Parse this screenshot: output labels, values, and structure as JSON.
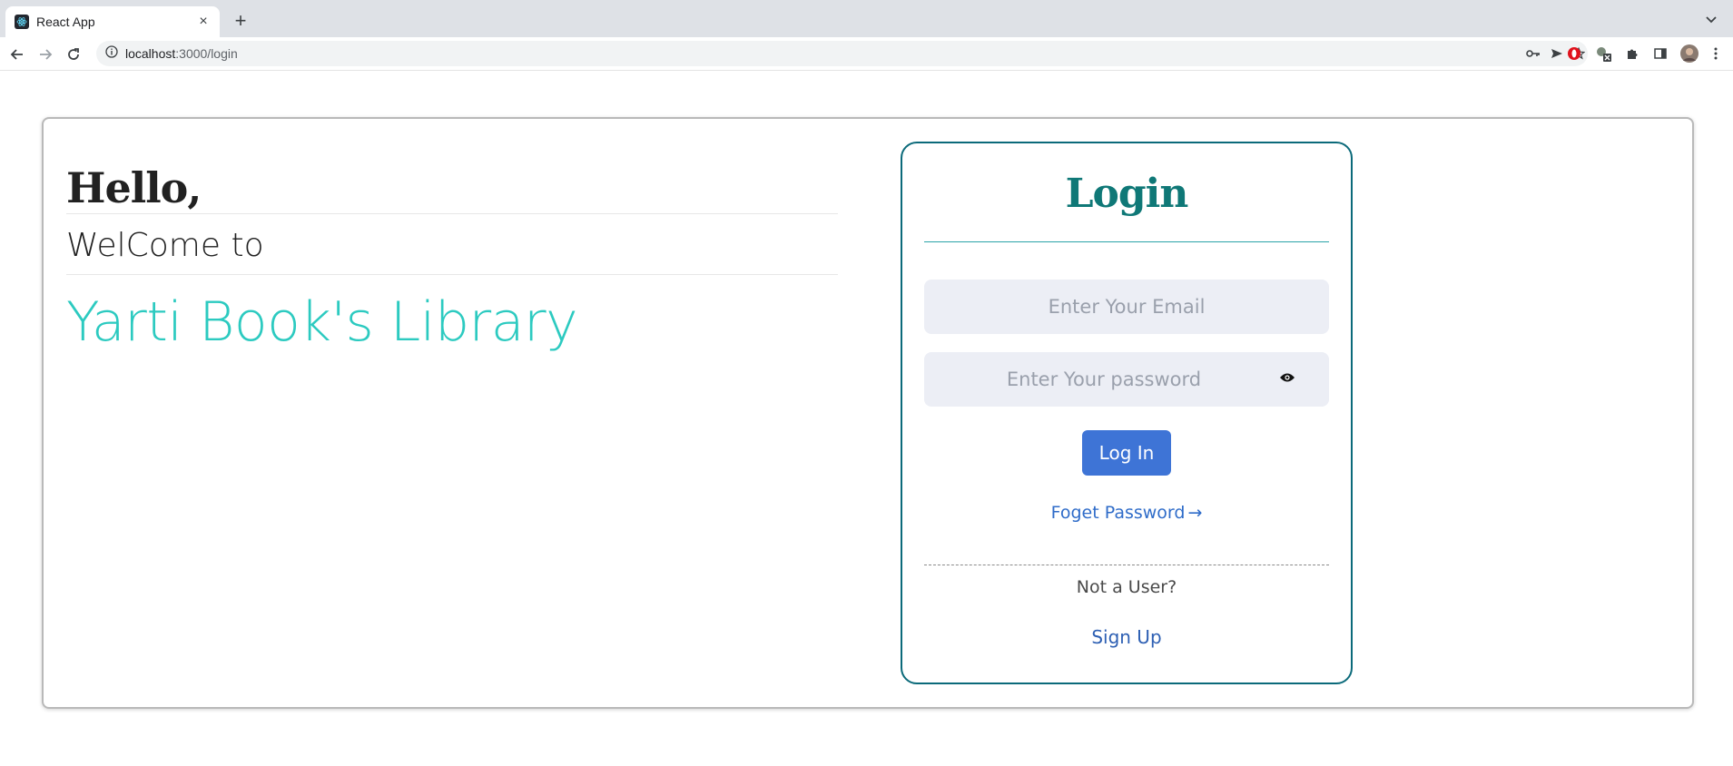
{
  "browser": {
    "tab_title": "React App",
    "new_tab_label": "+",
    "close_label": "×",
    "url_host": "localhost",
    "url_path": ":3000/login"
  },
  "page": {
    "greeting": "Hello,",
    "welcome": "WelCome to",
    "library_name": "Yarti Book's Library"
  },
  "login": {
    "title": "Login",
    "email_placeholder": "Enter Your Email",
    "password_placeholder": "Enter Your password",
    "login_button": "Log In",
    "forgot_link": "Foget Password",
    "forgot_arrow": "→",
    "not_user": "Not a User?",
    "signup_link": "Sign Up"
  },
  "colors": {
    "accent_teal": "#0f7877",
    "library_teal": "#2ccac0",
    "button_blue": "#3e74d6",
    "link_blue": "#2f6cc9"
  },
  "icons": {
    "favicon": "react-icon",
    "password_toggle": "eye-icon"
  }
}
